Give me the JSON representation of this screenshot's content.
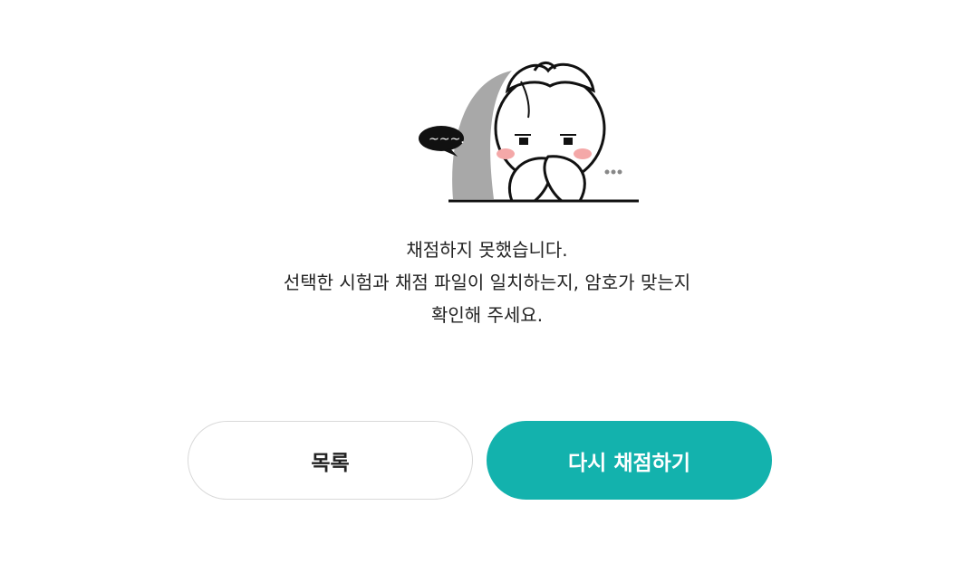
{
  "illustration": {
    "icon": "sad-character-illustration",
    "speech_bubble_text": "~~~.",
    "colors": {
      "shadow": "#a8a8a8",
      "outline": "#111111",
      "blush": "#f4a8a8"
    }
  },
  "message": {
    "line1": "채점하지 못했습니다.",
    "line2": "선택한 시험과 채점 파일이 일치하는지, 암호가 맞는지",
    "line3": "확인해 주세요."
  },
  "buttons": {
    "list_label": "목록",
    "retry_label": "다시 채점하기"
  },
  "colors": {
    "accent": "#13b2ad",
    "text": "#222222",
    "border": "#d9d9d9"
  }
}
